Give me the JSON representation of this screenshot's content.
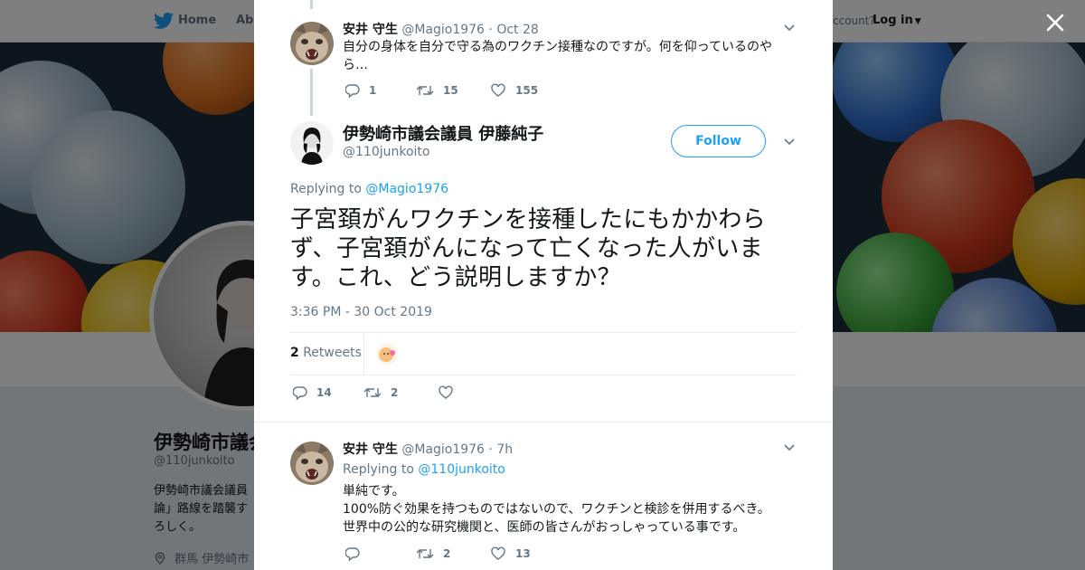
{
  "background": {
    "nav": {
      "home_label": "Home",
      "about_label": "Abo",
      "account_label": "ccount?",
      "login_label": "Log in"
    },
    "profile": {
      "name": "伊勢崎市議会",
      "handle": "@110junkoito",
      "bio_lines": [
        "伊勢崎市議会議員",
        "論」路線を踏襲す",
        "ろしく。"
      ],
      "location": "群馬 伊勢崎市"
    }
  },
  "modal": {
    "parent_tweet": {
      "name": "安井 守生",
      "handle": "@Magio1976",
      "time": "Oct 28",
      "text": "自分の身体を自分で守る為のワクチン接種なのですが。何を仰っているのやら…",
      "replies": "1",
      "retweets": "15",
      "likes": "155"
    },
    "main_tweet": {
      "name": "伊勢崎市議会議員 伊藤純子",
      "handle": "@110junkoito",
      "follow_label": "Follow",
      "replying_prefix": "Replying to",
      "replying_to": "@Magio1976",
      "text": "子宮頚がんワクチンを接種したにもかかわらず、子宮頚がんになって亡くなった人がいます。これ、どう説明しますか？",
      "timestamp": "3:36 PM - 30 Oct 2019",
      "retweet_count": "2",
      "retweet_word": "Retweets",
      "replies": "14",
      "retweets": "2"
    },
    "reply_tweet": {
      "name": "安井 守生",
      "handle": "@Magio1976",
      "time": "7h",
      "replying_prefix": "Replying to",
      "replying_to": "@110junkoito",
      "lines": [
        "単純です。",
        "100%防ぐ効果を持つものではないので、ワクチンと検診を併用するべき。",
        "世界中の公的な研究機関と、医師の皆さんがおっしゃっている事です。"
      ],
      "retweets": "2",
      "likes": "13"
    }
  },
  "icons": [
    "twitter-bird-icon",
    "close-icon",
    "chevron-down-icon",
    "reply-icon",
    "retweet-icon",
    "heart-icon",
    "location-pin-icon"
  ],
  "colors": {
    "accent": "#1da1f2",
    "text": "#14171a",
    "secondary": "#657786",
    "border": "#e6ecf0"
  }
}
